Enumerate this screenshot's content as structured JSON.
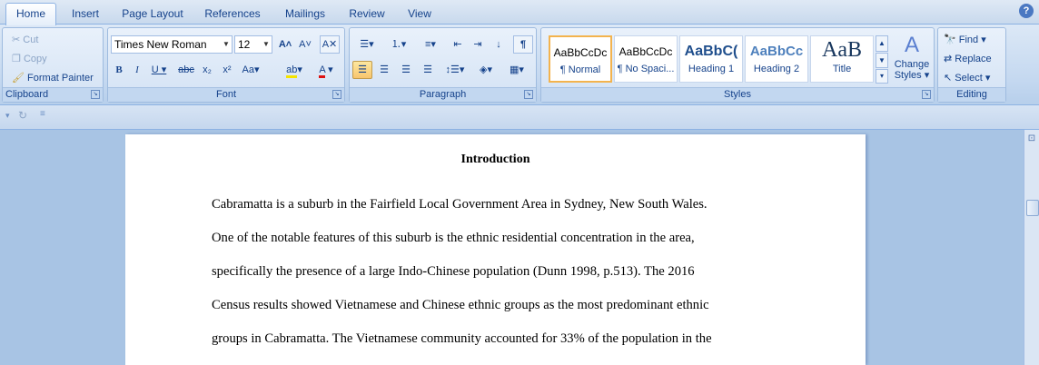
{
  "tabs": [
    "Home",
    "Insert",
    "Page Layout",
    "References",
    "Mailings",
    "Review",
    "View"
  ],
  "clipboard": {
    "group_label": "Clipboard",
    "cut": "Cut",
    "copy": "Copy",
    "format_painter": "Format Painter"
  },
  "font": {
    "group_label": "Font",
    "family": "Times New Roman",
    "size": "12"
  },
  "paragraph": {
    "group_label": "Paragraph"
  },
  "styles": {
    "group_label": "Styles",
    "items": [
      {
        "sample": "AaBbCcDc",
        "name": "¶ Normal"
      },
      {
        "sample": "AaBbCcDc",
        "name": "¶ No Spaci..."
      },
      {
        "sample": "AaBbC(",
        "name": "Heading 1"
      },
      {
        "sample": "AaBbCc",
        "name": "Heading 2"
      },
      {
        "sample": "AaB",
        "name": "Title"
      }
    ],
    "change_styles_line1": "Change",
    "change_styles_line2": "Styles"
  },
  "editing": {
    "group_label": "Editing",
    "find": "Find",
    "replace": "Replace",
    "select": "Select"
  },
  "document": {
    "title": "Introduction",
    "lines": [
      "Cabramatta is a suburb in the Fairfield Local Government Area in Sydney, New South Wales.",
      "One of the notable features of this suburb is the ethnic residential concentration in the area,",
      "specifically the presence of a large Indo-Chinese population (Dunn 1998, p.513). The 2016",
      "Census results showed Vietnamese and Chinese ethnic groups as the most predominant ethnic",
      "groups in Cabramatta. The Vietnamese community accounted for 33% of the population in the"
    ]
  }
}
